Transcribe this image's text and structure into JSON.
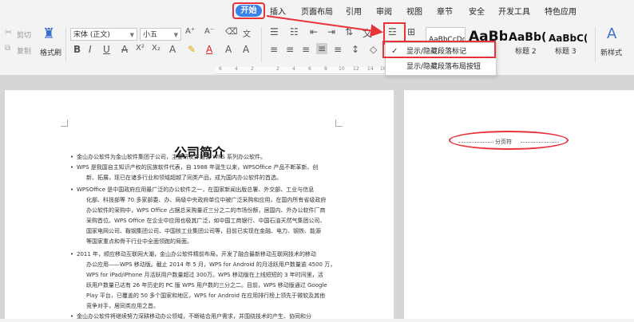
{
  "menu": {
    "active": "开始",
    "items": [
      "插入",
      "页面布局",
      "引用",
      "审阅",
      "视图",
      "章节",
      "安全",
      "开发工具",
      "特色应用"
    ]
  },
  "toolbar": {
    "cut_label": "剪切",
    "copy_label": "复制",
    "format_painter_label": "格式刷",
    "font_name": "宋体 (正文)",
    "font_size": "小五",
    "styles": {
      "previews": [
        "AaBbCcDd",
        "AaBb",
        "AaBb(",
        "AaBbC("
      ],
      "captions": [
        "标题 2",
        "标题 3"
      ]
    },
    "new_style_label": "新样式"
  },
  "dropdown": {
    "items": [
      {
        "label": "显示/隐藏段落标记",
        "checked": true
      },
      {
        "label": "显示/隐藏段落布局按钮",
        "checked": false
      }
    ]
  },
  "ruler": {
    "numbers": [
      "6",
      "4",
      "2",
      "2",
      "4",
      "6",
      "8",
      "10",
      "12",
      "14",
      "16",
      "18",
      "20"
    ]
  },
  "document": {
    "title": "公司简介",
    "paragraphs": [
      [
        "金山办公软件为金山软件集团子公司，主要研发并运营 WPS 系列办公软件。"
      ],
      [
        "WPS 是我国自主知识产权的民族软件代表，自 1988 年诞生以来，WPSOffice 产品不断革新、创",
        "新、拓展，现已在诸多行业和领域超越了同类产品，成为国内办公软件的首选。"
      ],
      [
        "WPSOffice 是中国政府应用最广泛的办公软件之一，在国家新闻出版总署、外交部、工业与信息",
        "化部、科技部等 70 多家部委、办、局级中央政府单位中被广泛采购和应用，在国内所有省级政府",
        "办公软件的采购中，WPS Office 占据总采购量近三分之二的市场份额，居国内、外办公软件厂商",
        "采购首位。WPS Office 在企业中应用也极其广泛，如中国工商银行、中国石油天然气集团公司、",
        "国家电网公司、鞍钢集团公司、中国核工业集团公司等，目前已实现在金融、电力、钢铁、能源",
        "等国家重点和骨干行业中全面领跑的局面。"
      ],
      [
        "2011 年，顺应移动互联网大潮，金山办公软件精前布局，开发了融合最新移动互联网技术的移动",
        "办公应用——WPS 移动版。截止 2014 年 5 月，WPS for Android 的月活跃用户数量逾 4500 万，",
        "WPS for iPad/iPhone 月活跃用户数量超过 300万。WPS 移动版在上线短短的 3 年时间里，活",
        "跃用户数量已达有 26 年历史的 PC 版 WPS 用户数的三分之二。目前，WPS 移动版通过 Google",
        "Play 平台，已覆盖的 50 多个国家和地区，WPS for Android 在应用排行榜上领先于微软及其他",
        "竞争对手，居同类应用之首。"
      ],
      [
        "金山办公软件将继续努力深耕移动办公领域，不断结合用户需求，并围绕技术的产生、协同和分"
      ]
    ]
  },
  "footer": {
    "text": "分页符"
  }
}
